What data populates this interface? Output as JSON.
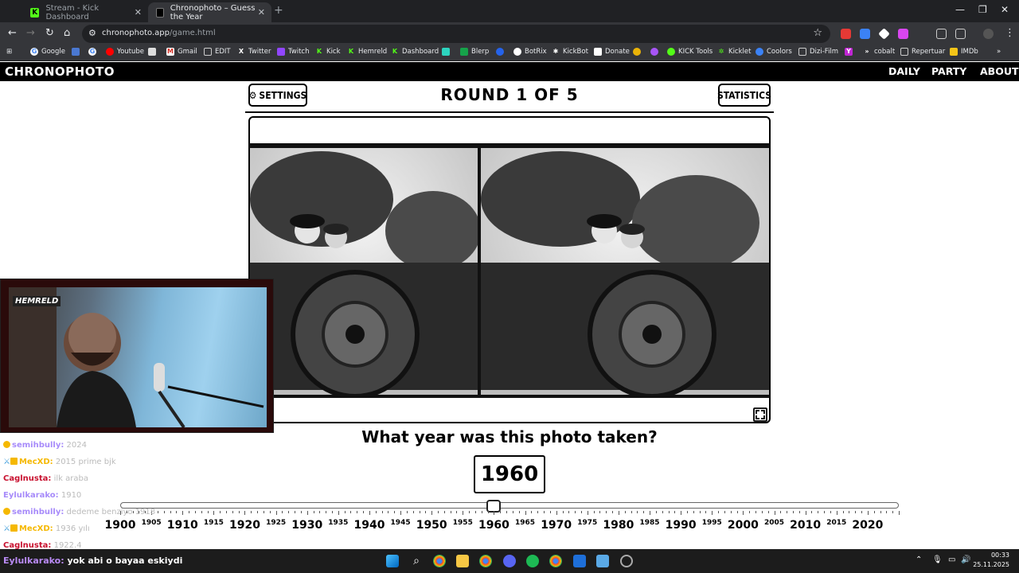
{
  "browser": {
    "tabs": [
      {
        "label": "Stream - Kick Dashboard",
        "active": false
      },
      {
        "label": "Chronophoto – Guess the Year",
        "active": true
      }
    ],
    "url_host": "chronophoto.app",
    "url_path": "/game.html",
    "bookmarks": [
      "Google",
      "Youtube",
      "Gmail",
      "EDIT",
      "Twitter",
      "Twitch",
      "Kick",
      "Hemreld",
      "Dashboard",
      "Blerp",
      "BotRix",
      "KickBot",
      "Donate",
      "KICK Tools",
      "Kicklet",
      "Coolors",
      "Dizi-Film",
      "cobalt",
      "Repertuar",
      "IMDb"
    ]
  },
  "site": {
    "logo": "CHRONOPHOTO",
    "nav": [
      "DAILY",
      "PARTY",
      "ABOUT"
    ]
  },
  "game": {
    "settings_label": "SETTINGS",
    "statistics_label": "STATISTICS",
    "round_title": "ROUND 1 OF 5",
    "question": "What year was this photo taken?",
    "year_value": "1960",
    "slider": {
      "min": 1900,
      "max": 2025,
      "value": 1960
    },
    "major_years": [
      "1900",
      "1910",
      "1920",
      "1930",
      "1940",
      "1950",
      "1960",
      "1970",
      "1980",
      "1990",
      "2000",
      "2010",
      "2020"
    ],
    "minor_years": [
      "1905",
      "1915",
      "1925",
      "1935",
      "1945",
      "1955",
      "1965",
      "1975",
      "1985",
      "1995",
      "2005",
      "2015"
    ]
  },
  "stream": {
    "cam_tag": "HEMRELD",
    "chat": [
      {
        "user": "semihbully:",
        "msg": "2024",
        "color": "#a78bfa",
        "badge": "#f5b800"
      },
      {
        "user": "MecXD:",
        "msg": "2015 prime bjk",
        "color": "#f5b800",
        "badge": "#4aa3df"
      },
      {
        "user": "Caglnusta:",
        "msg": "ilk araba",
        "color": "#c8102e",
        "badge": ""
      },
      {
        "user": "Eylulkarako:",
        "msg": "1910",
        "color": "#a78bfa",
        "badge": ""
      },
      {
        "user": "semihbully:",
        "msg": "dedeme benziyo 1918",
        "color": "#a78bfa",
        "badge": "#f5b800"
      },
      {
        "user": "MecXD:",
        "msg": "1936 yılı",
        "color": "#f5b800",
        "badge": "#4aa3df"
      },
      {
        "user": "Caglnusta:",
        "msg": "1922.4",
        "color": "#c8102e",
        "badge": ""
      }
    ],
    "caption_user": "Eylulkarako:",
    "caption_msg": "yok abi o bayaa eskiydi"
  },
  "taskbar": {
    "time": "00:33",
    "date": "25.11.2025"
  }
}
